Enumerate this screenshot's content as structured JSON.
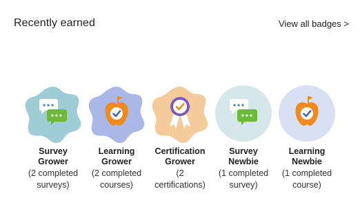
{
  "header": {
    "title": "Recently earned",
    "view_all": "View all badges >"
  },
  "badges": [
    {
      "name_line1": "Survey",
      "name_line2": "Grower",
      "desc_line1": "(2 completed",
      "desc_line2": "surveys)",
      "icon": "chat-bubbles-icon",
      "shape": "flower",
      "bg_color": "#9fcdd5"
    },
    {
      "name_line1": "Learning",
      "name_line2": "Grower",
      "desc_line1": "(2 completed",
      "desc_line2": "courses)",
      "icon": "apple-check-icon",
      "shape": "flower",
      "bg_color": "#a9b8e6"
    },
    {
      "name_line1": "Certification",
      "name_line2": "Grower",
      "desc_line1": "(2",
      "desc_line2": "certifications)",
      "icon": "ribbon-check-icon",
      "shape": "flower",
      "bg_color": "#f4cc9c"
    },
    {
      "name_line1": "Survey",
      "name_line2": "Newbie",
      "desc_line1": "(1 completed",
      "desc_line2": "survey)",
      "icon": "chat-bubbles-icon",
      "shape": "circle",
      "bg_color": "#d5e7ea"
    },
    {
      "name_line1": "Learning",
      "name_line2": "Newbie",
      "desc_line1": "(1 completed",
      "desc_line2": "course)",
      "icon": "apple-check-icon",
      "shape": "circle",
      "bg_color": "#d8e0f4"
    }
  ],
  "colors": {
    "chat_white": "#ffffff",
    "chat_green": "#6cb93b",
    "chat_dots_blue": "#3f7dc1",
    "apple_orange": "#f08a1c",
    "apple_face": "#ffffff",
    "check_blue": "#3567c4",
    "ribbon_purple": "#7d5cc0",
    "ribbon_white": "#ffffff"
  }
}
